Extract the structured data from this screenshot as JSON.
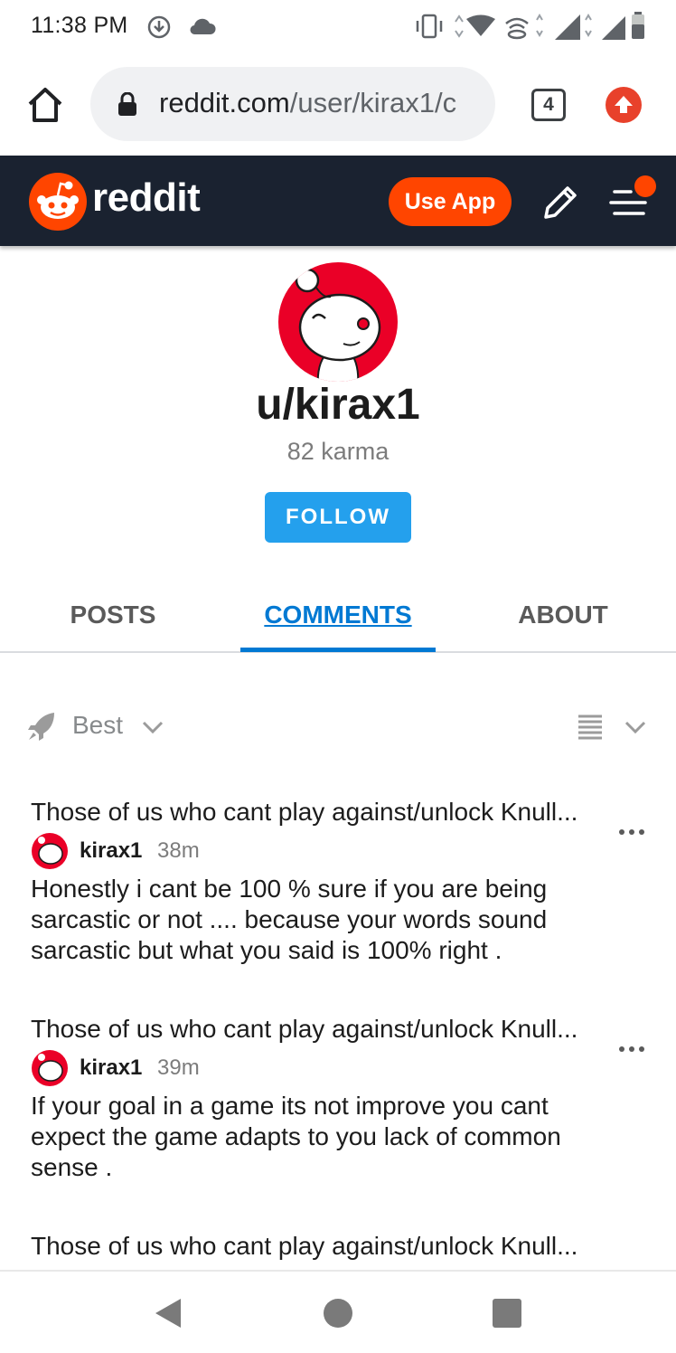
{
  "status_bar": {
    "time": "11:38 PM"
  },
  "browser": {
    "url_host": "reddit.com",
    "url_path": "/user/kirax1/c",
    "tab_count": "4"
  },
  "header": {
    "brand": "reddit",
    "use_app_label": "Use App",
    "accent": "#ff4500",
    "bg": "#1a2230"
  },
  "profile": {
    "username": "u/kirax1",
    "karma": "82 karma",
    "follow_label": "FOLLOW"
  },
  "tabs": [
    {
      "label": "POSTS",
      "active": false
    },
    {
      "label": "COMMENTS",
      "active": true
    },
    {
      "label": "ABOUT",
      "active": false
    }
  ],
  "sort": {
    "label": "Best"
  },
  "comments": [
    {
      "post_title": "Those of us who cant play against/unlock Knull...",
      "author": "kirax1",
      "time": "38m",
      "body": "Honestly i cant be 100 % sure if you are being sarcastic or not .... because your words sound sarcastic but what you said is 100% right ."
    },
    {
      "post_title": "Those of us who cant play against/unlock Knull...",
      "author": "kirax1",
      "time": "39m",
      "body": "If your goal in a game its not improve you cant expect the game adapts to you lack of common sense ."
    },
    {
      "post_title": "Those of us who cant play against/unlock Knull..."
    }
  ]
}
